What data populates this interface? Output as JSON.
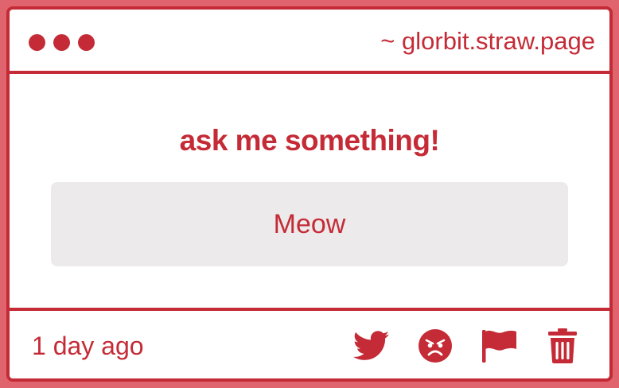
{
  "header": {
    "url": "~ glorbit.straw.page"
  },
  "main": {
    "prompt": "ask me something!",
    "answer": "Meow"
  },
  "footer": {
    "timestamp": "1 day ago",
    "actions": [
      {
        "icon": "twitter-icon"
      },
      {
        "icon": "angry-face-icon"
      },
      {
        "icon": "flag-icon"
      },
      {
        "icon": "trash-icon"
      }
    ]
  },
  "colors": {
    "accent": "#c42b36",
    "background": "#e0646d",
    "card": "#ffffff",
    "answer_bg": "#eceaeb"
  }
}
